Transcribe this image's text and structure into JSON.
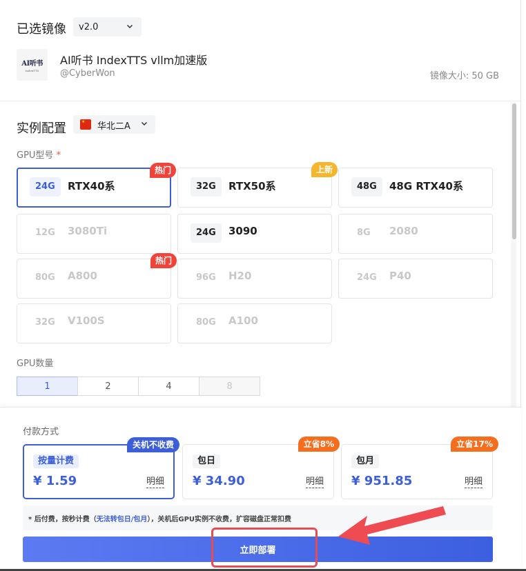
{
  "image_section": {
    "title": "已选镜像",
    "version": "v2.0",
    "logo_text": "AI听书",
    "logo_sub": "IndexTTS",
    "app_name": "AI听书 IndexTTS vllm加速版",
    "author": "@CyberWon",
    "size_text": "镜像大小: 50 GB"
  },
  "instance": {
    "title": "实例配置",
    "region_flag": "cn-flag-icon",
    "region": "华北二A"
  },
  "gpu_model": {
    "label": "GPU型号",
    "required": "*",
    "cards": [
      {
        "mem": "24G",
        "model": "RTX40系",
        "tag": "热门",
        "state": "selected"
      },
      {
        "mem": "32G",
        "model": "RTX50系",
        "tag": "上新",
        "state": "normal"
      },
      {
        "mem": "48G",
        "model": "48G RTX40系",
        "tag": "",
        "state": "normal"
      },
      {
        "mem": "12G",
        "model": "3080Ti",
        "tag": "",
        "state": "disabled"
      },
      {
        "mem": "24G",
        "model": "3090",
        "tag": "",
        "state": "normal"
      },
      {
        "mem": "8G",
        "model": "2080",
        "tag": "",
        "state": "disabled"
      },
      {
        "mem": "80G",
        "model": "A800",
        "tag": "热门",
        "state": "disabled"
      },
      {
        "mem": "96G",
        "model": "H20",
        "tag": "",
        "state": "disabled"
      },
      {
        "mem": "24G",
        "model": "P40",
        "tag": "",
        "state": "disabled"
      },
      {
        "mem": "32G",
        "model": "V100S",
        "tag": "",
        "state": "disabled"
      },
      {
        "mem": "80G",
        "model": "A100",
        "tag": "",
        "state": "disabled"
      }
    ]
  },
  "gpu_count": {
    "label": "GPU数量",
    "options": [
      "1",
      "2",
      "4",
      "8"
    ],
    "selected": "1",
    "disabled": [
      "8"
    ]
  },
  "payment": {
    "title": "付款方式",
    "cards": [
      {
        "name": "按量计费",
        "price": "¥ 1.59",
        "detail": "明细",
        "tag": "关机不收费",
        "state": "selected"
      },
      {
        "name": "包日",
        "price": "¥ 34.90",
        "detail": "明细",
        "tag": "立省8%",
        "state": "normal"
      },
      {
        "name": "包月",
        "price": "¥ 951.85",
        "detail": "明细",
        "tag": "立省17%",
        "state": "normal"
      }
    ],
    "note_prefix": "* 后付费，按秒计费（",
    "note_highlight": "无法转包日/包月",
    "note_suffix": "），关机后GPU实例不收费，扩容磁盘正常扣费",
    "deploy_label": "立即部署"
  },
  "colors": {
    "accent": "#3c5fd8",
    "hot_tag": "#f0433a",
    "new_tag": "#f6b62b",
    "saving_tag": "#f46e1e",
    "annotation": "#e54d54"
  }
}
